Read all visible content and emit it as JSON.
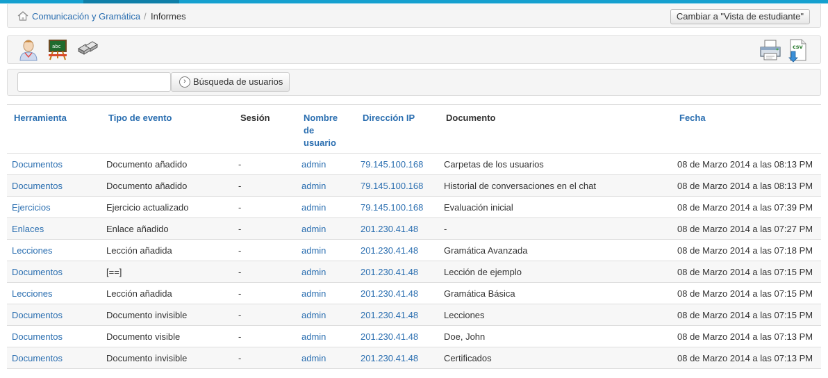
{
  "breadcrumb": {
    "course": "Comunicación y Gramática",
    "separator": "/",
    "current": "Informes"
  },
  "header": {
    "student_view_button": "Cambiar a \"Vista de estudiante\""
  },
  "toolbar": {
    "left_icons": [
      "user-icon",
      "course-chalkboard-icon",
      "tools-icon"
    ],
    "right_icons": [
      "print-icon",
      "csv-export-icon"
    ],
    "csv_label": "csv"
  },
  "search": {
    "value": "",
    "button_label": "Búsqueda de usuarios"
  },
  "table": {
    "columns": [
      {
        "label": "Herramienta",
        "sortable": true
      },
      {
        "label": "Tipo de evento",
        "sortable": true
      },
      {
        "label": "Sesión",
        "sortable": false
      },
      {
        "label": "Nombre de usuario",
        "sortable": true
      },
      {
        "label": "Dirección IP",
        "sortable": true
      },
      {
        "label": "Documento",
        "sortable": false
      },
      {
        "label": "Fecha",
        "sortable": true
      }
    ],
    "rows": [
      {
        "tool": "Documentos",
        "event": "Documento añadido",
        "session": "-",
        "user": "admin",
        "ip": "79.145.100.168",
        "document": "Carpetas de los usuarios",
        "date": "08 de Marzo 2014 a las 08:13 PM"
      },
      {
        "tool": "Documentos",
        "event": "Documento añadido",
        "session": "-",
        "user": "admin",
        "ip": "79.145.100.168",
        "document": "Historial de conversaciones en el chat",
        "date": "08 de Marzo 2014 a las 08:13 PM"
      },
      {
        "tool": "Ejercicios",
        "event": "Ejercicio actualizado",
        "session": "-",
        "user": "admin",
        "ip": "79.145.100.168",
        "document": "Evaluación inicial",
        "date": "08 de Marzo 2014 a las 07:39 PM"
      },
      {
        "tool": "Enlaces",
        "event": "Enlace añadido",
        "session": "-",
        "user": "admin",
        "ip": "201.230.41.48",
        "document": "-",
        "date": "08 de Marzo 2014 a las 07:27 PM"
      },
      {
        "tool": "Lecciones",
        "event": "Lección añadida",
        "session": "-",
        "user": "admin",
        "ip": "201.230.41.48",
        "document": "Gramática Avanzada",
        "date": "08 de Marzo 2014 a las 07:18 PM"
      },
      {
        "tool": "Documentos",
        "event": "[==]",
        "session": "-",
        "user": "admin",
        "ip": "201.230.41.48",
        "document": "Lección de ejemplo",
        "date": "08 de Marzo 2014 a las 07:15 PM"
      },
      {
        "tool": "Lecciones",
        "event": "Lección añadida",
        "session": "-",
        "user": "admin",
        "ip": "201.230.41.48",
        "document": "Gramática Básica",
        "date": "08 de Marzo 2014 a las 07:15 PM"
      },
      {
        "tool": "Documentos",
        "event": "Documento invisible",
        "session": "-",
        "user": "admin",
        "ip": "201.230.41.48",
        "document": "Lecciones",
        "date": "08 de Marzo 2014 a las 07:15 PM"
      },
      {
        "tool": "Documentos",
        "event": "Documento visible",
        "session": "-",
        "user": "admin",
        "ip": "201.230.41.48",
        "document": "Doe, John",
        "date": "08 de Marzo 2014 a las 07:13 PM"
      },
      {
        "tool": "Documentos",
        "event": "Documento invisible",
        "session": "-",
        "user": "admin",
        "ip": "201.230.41.48",
        "document": "Certificados",
        "date": "08 de Marzo 2014 a las 07:13 PM"
      }
    ]
  },
  "colors": {
    "accent": "#15a0cf",
    "link": "#2a6eb0",
    "row_alt": "#f7f7f7",
    "border": "#dddddd"
  }
}
